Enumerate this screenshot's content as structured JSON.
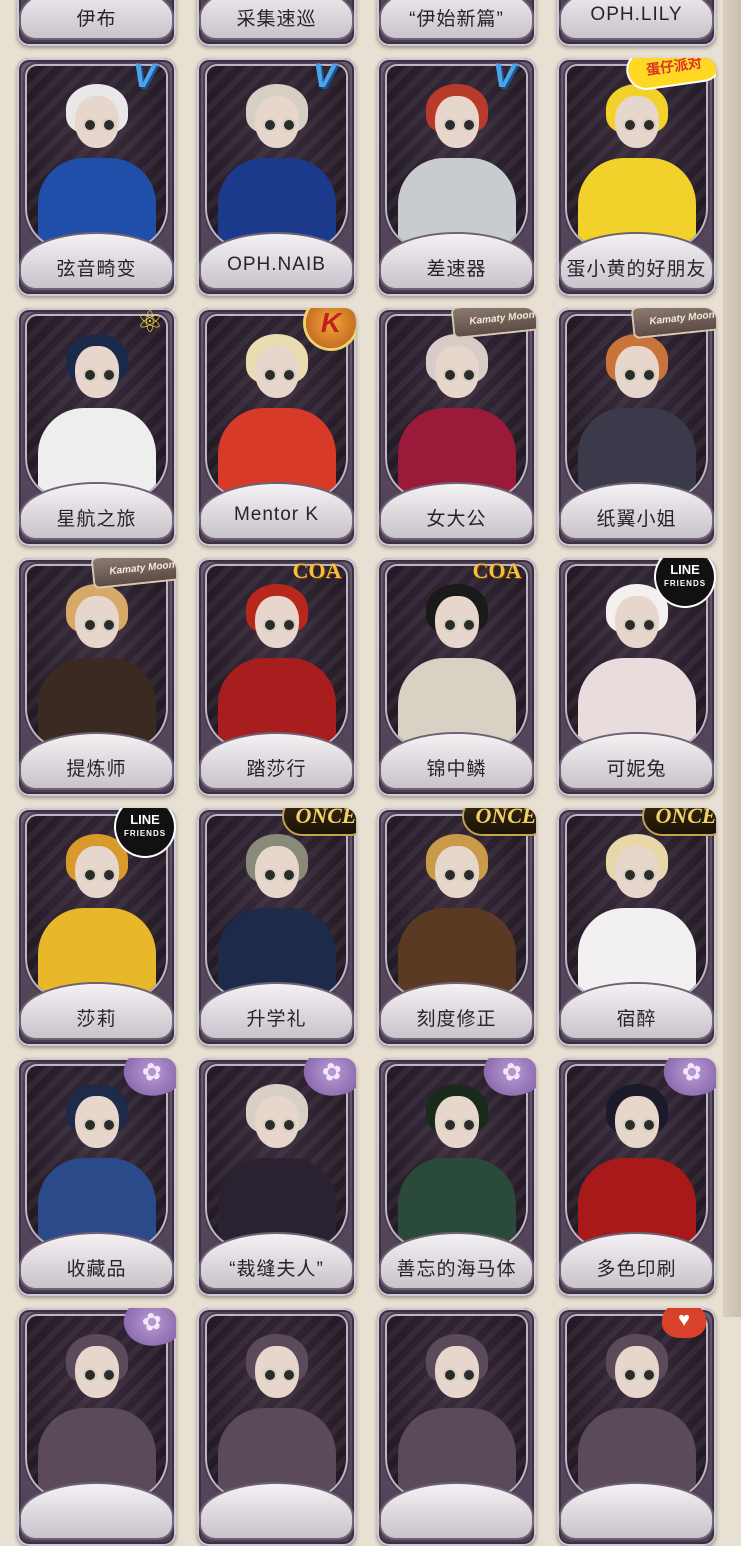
{
  "rows": [
    {
      "cards": [
        {
          "name": "伊布",
          "badge": "",
          "hair": "#cfcfcf",
          "outfit": "#7a6e8a"
        },
        {
          "name": "采集速巡",
          "badge": "",
          "hair": "#5b4a3f",
          "outfit": "#8a7a68"
        },
        {
          "name": "“伊始新篇”",
          "badge": "",
          "hair": "#4a3a3a",
          "outfit": "#9a8a7a"
        },
        {
          "name": "OPH.LILY",
          "badge": "",
          "hair": "#d8c8a8",
          "outfit": "#a89a8a"
        }
      ]
    },
    {
      "cards": [
        {
          "name": "弦音畸变",
          "badge": "v",
          "badge_text": "V",
          "hair": "#e8e8e8",
          "outfit": "#1f4fa8"
        },
        {
          "name": "OPH.NAIB",
          "badge": "v",
          "badge_text": "V",
          "hair": "#d6d0c4",
          "outfit": "#1c3a8c"
        },
        {
          "name": "差速器",
          "badge": "v",
          "badge_text": "V",
          "hair": "#b83a2a",
          "outfit": "#c8ccd0"
        },
        {
          "name": "蛋小黄的好朋友",
          "badge": "egg",
          "badge_text": "蛋仔派对",
          "hair": "#f2d22a",
          "outfit": "#f2d22a"
        }
      ]
    },
    {
      "cards": [
        {
          "name": "星航之旅",
          "badge": "atom",
          "badge_text": "⚛",
          "hair": "#1b2a4a",
          "outfit": "#eeeeee"
        },
        {
          "name": "Mentor K",
          "badge": "k",
          "badge_text": "K",
          "hair": "#e8dcb0",
          "outfit": "#d83a2a"
        },
        {
          "name": "女大公",
          "badge": "kamaty",
          "badge_text": "Kamaty Moon",
          "hair": "#d8ccc8",
          "outfit": "#9a1a3a"
        },
        {
          "name": "纸翼小姐",
          "badge": "kamaty",
          "badge_text": "Kamaty Moon",
          "hair": "#c8743a",
          "outfit": "#3a3a4a"
        }
      ]
    },
    {
      "cards": [
        {
          "name": "提炼师",
          "badge": "kamaty",
          "badge_text": "Kamaty Moon",
          "hair": "#d8a868",
          "outfit": "#3a2a22"
        },
        {
          "name": "踏莎行",
          "badge": "coa",
          "badge_text": "COA",
          "hair": "#b8281a",
          "outfit": "#a81e1e"
        },
        {
          "name": "锦中鳞",
          "badge": "coa",
          "badge_text": "COA",
          "hair": "#1a1a1a",
          "outfit": "#d8d2c4"
        },
        {
          "name": "可妮兔",
          "badge": "line",
          "badge_text": "LINE",
          "badge_sub": "FRIENDS",
          "hair": "#f4f0f0",
          "outfit": "#e8dcdc"
        }
      ]
    },
    {
      "cards": [
        {
          "name": "莎莉",
          "badge": "line",
          "badge_text": "LINE",
          "badge_sub": "FRIENDS",
          "hair": "#d89a2a",
          "outfit": "#e8b82a"
        },
        {
          "name": "升学礼",
          "badge": "once",
          "badge_text": "ONCE",
          "hair": "#8a8a7a",
          "outfit": "#1e2a4a"
        },
        {
          "name": "刻度修正",
          "badge": "once",
          "badge_text": "ONCE",
          "hair": "#c89a4a",
          "outfit": "#5a3a22"
        },
        {
          "name": "宿醉",
          "badge": "once",
          "badge_text": "ONCE",
          "hair": "#e8d8a8",
          "outfit": "#f2f0f0"
        }
      ]
    },
    {
      "cards": [
        {
          "name": "收藏品",
          "badge": "flower",
          "badge_text": "✿",
          "hair": "#1e2a4a",
          "outfit": "#2a4a8a"
        },
        {
          "name": "“裁缝夫人”",
          "badge": "flower",
          "badge_text": "✿",
          "hair": "#d8d0c4",
          "outfit": "#2a2230"
        },
        {
          "name": "善忘的海马体",
          "badge": "flower",
          "badge_text": "✿",
          "hair": "#1a2a1a",
          "outfit": "#2a4a3a"
        },
        {
          "name": "多色印刷",
          "badge": "flower",
          "badge_text": "✿",
          "hair": "#1a1a2a",
          "outfit": "#a81a1a"
        }
      ]
    },
    {
      "cards": [
        {
          "name": "",
          "badge": "flower",
          "badge_text": "✿",
          "hair": "#5a4a5a",
          "outfit": "#5a4a5a"
        },
        {
          "name": "",
          "badge": "",
          "hair": "#5a4a5a",
          "outfit": "#5a4a5a"
        },
        {
          "name": "",
          "badge": "",
          "hair": "#5a4a5a",
          "outfit": "#5a4a5a"
        },
        {
          "name": "",
          "badge": "heart",
          "badge_text": "♥",
          "hair": "#5a4a5a",
          "outfit": "#5a4a5a"
        }
      ]
    }
  ]
}
